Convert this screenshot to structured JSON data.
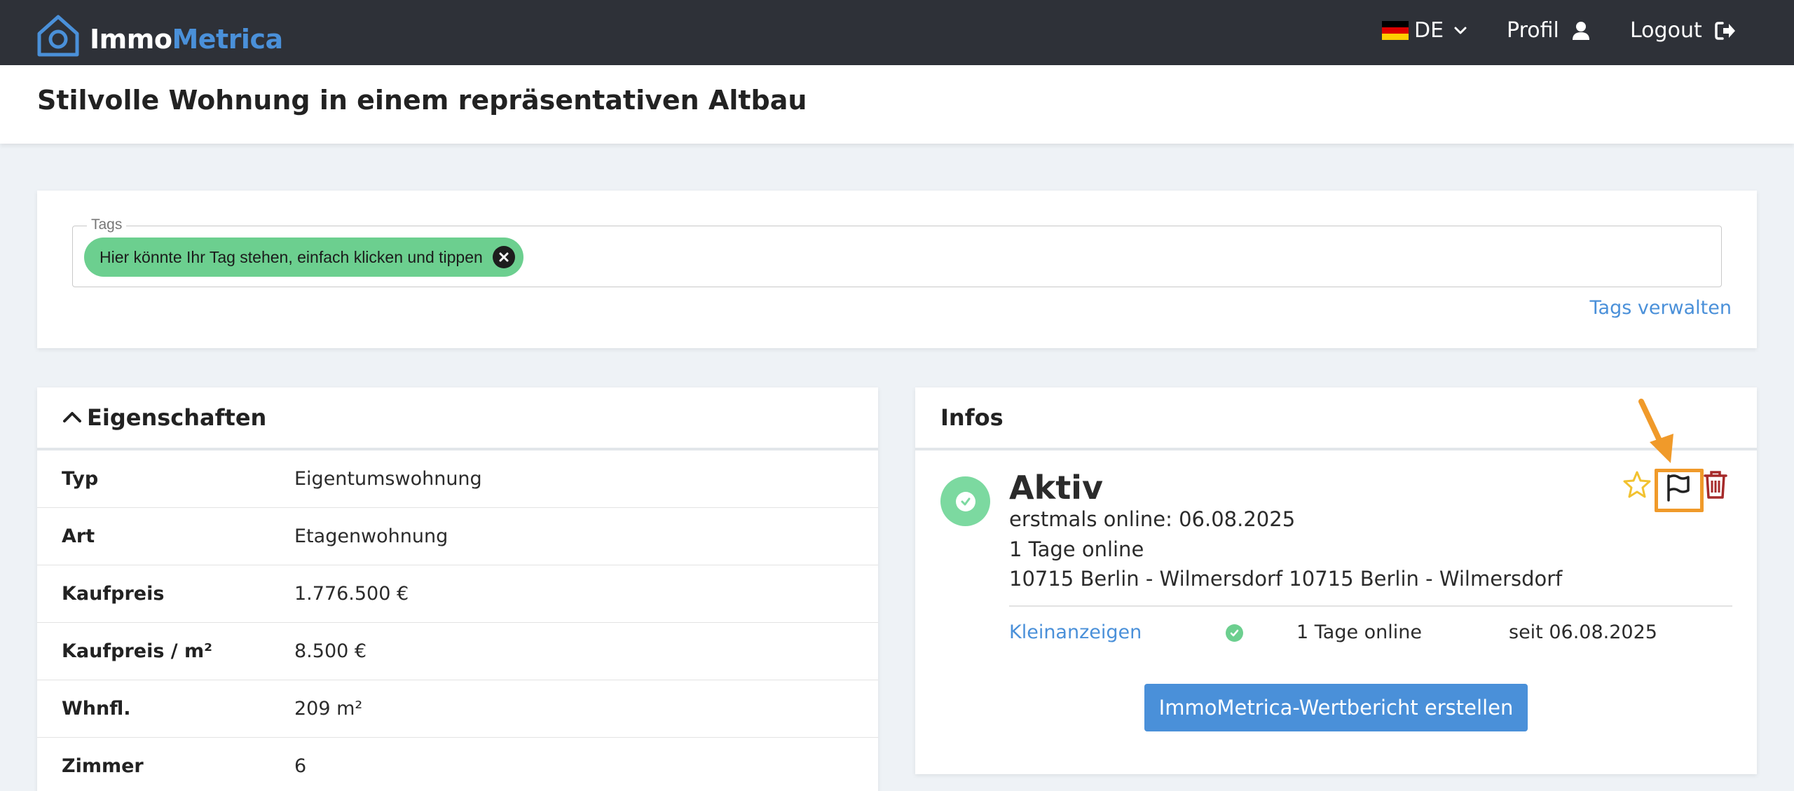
{
  "brand": {
    "name_part1": "Immo",
    "name_part2": "Metrica",
    "color": "#4a90d9"
  },
  "nav": {
    "language": "DE",
    "profile_label": "Profil",
    "logout_label": "Logout",
    "icons": {
      "language": "chevron-down-icon",
      "profile": "user-icon",
      "logout": "sign-out-icon"
    }
  },
  "page": {
    "title": "Stilvolle Wohnung in einem repräsentativen Altbau"
  },
  "tags": {
    "legend": "Tags",
    "chips": [
      {
        "label": "Hier könnte Ihr Tag stehen, einfach klicken und tippen"
      }
    ],
    "manage_label": "Tags verwalten"
  },
  "properties": {
    "title": "Eigenschaften",
    "rows": [
      {
        "label": "Typ",
        "value": "Eigentumswohnung"
      },
      {
        "label": "Art",
        "value": "Etagenwohnung"
      },
      {
        "label": "Kaufpreis",
        "value": "1.776.500 €"
      },
      {
        "label": "Kaufpreis / m²",
        "value": "8.500 €"
      },
      {
        "label": "Whnfl.",
        "value": "209 m²"
      },
      {
        "label": "Zimmer",
        "value": "6"
      }
    ]
  },
  "infos": {
    "title": "Infos",
    "status": "Aktiv",
    "first_online": "erstmals online: 06.08.2025",
    "days_online": "1 Tage online",
    "location": "10715 Berlin - Wilmersdorf 10715 Berlin - Wilmersdorf",
    "sources": [
      {
        "name": "Kleinanzeigen",
        "days": "1 Tage online",
        "since": "seit 06.08.2025"
      }
    ],
    "report_button": "ImmoMetrica-Wertbericht erstellen",
    "colors": {
      "active": "#7cd9a0",
      "star": "#f2c230",
      "delete": "#a52a2a",
      "highlight": "#f09a2a"
    }
  }
}
